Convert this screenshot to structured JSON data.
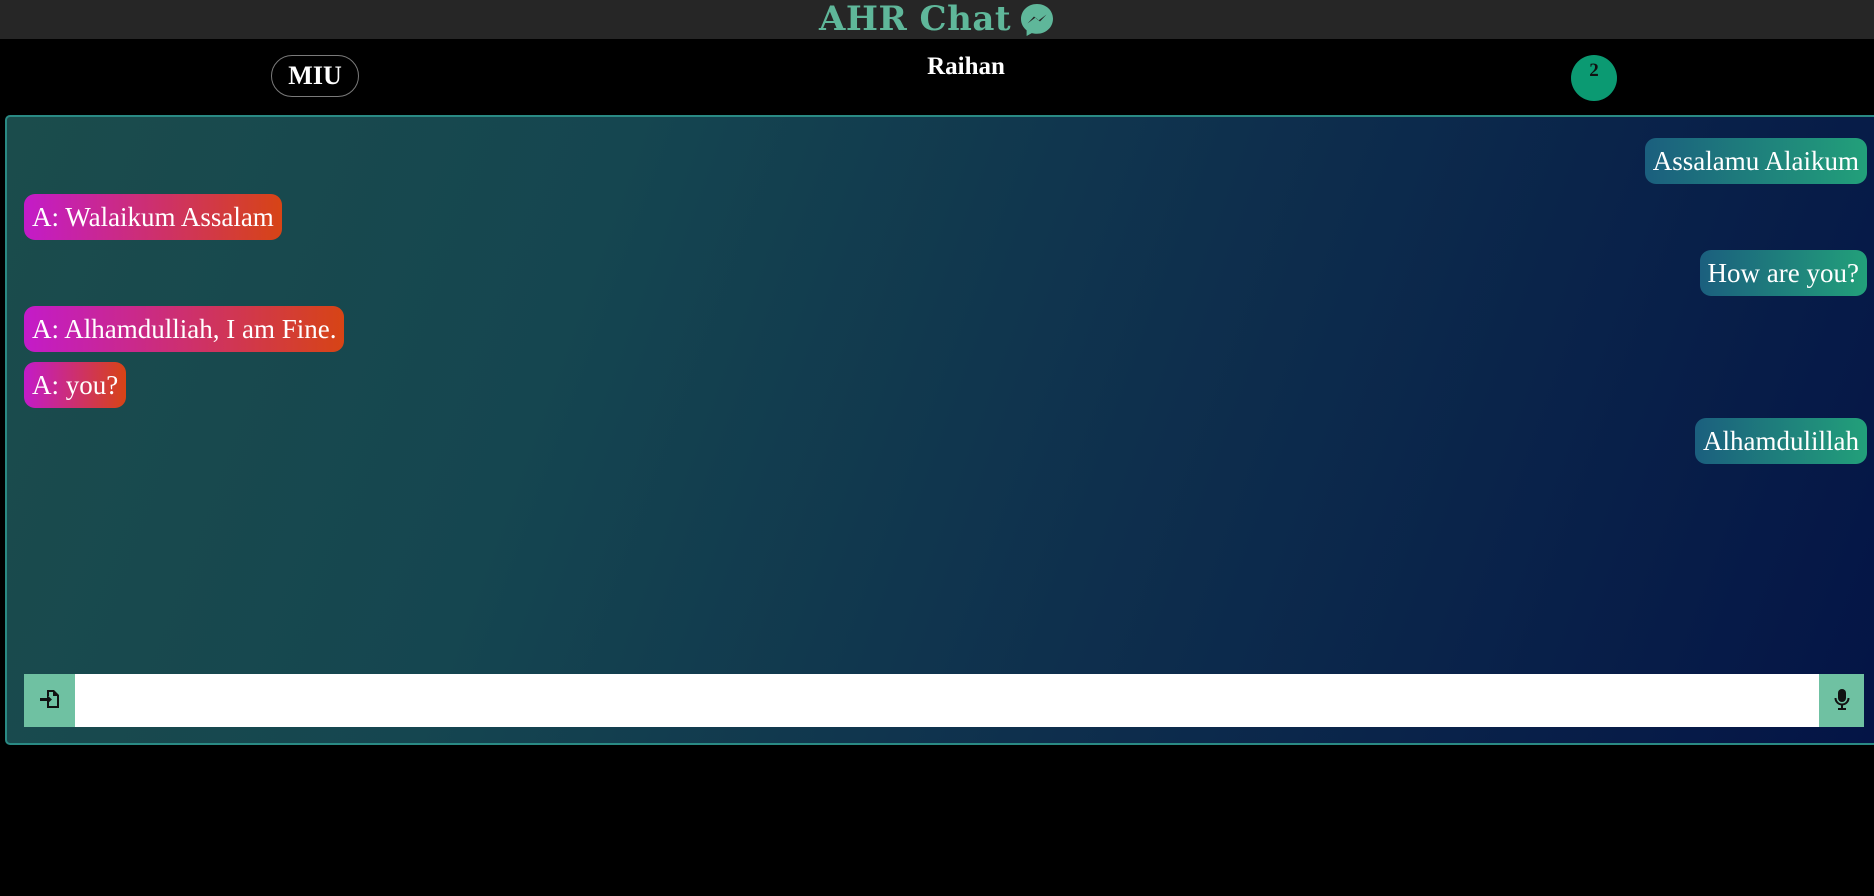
{
  "app": {
    "title": "AHR Chat",
    "title_color": "#5fb79a",
    "icon": "messenger-icon"
  },
  "header": {
    "room_label": "MIU",
    "user_name": "Raihan",
    "online_count": "2",
    "badge_color": "#0b9a72"
  },
  "messages": [
    {
      "direction": "outgoing",
      "text": "Assalamu Alaikum"
    },
    {
      "direction": "incoming",
      "text": "A: Walaikum Assalam"
    },
    {
      "direction": "outgoing",
      "text": "How are you?"
    },
    {
      "direction": "incoming",
      "text": "A: Alhamdulliah, I am Fine."
    },
    {
      "direction": "incoming",
      "text": "A: you?"
    },
    {
      "direction": "outgoing",
      "text": "Alhamdulillah"
    }
  ],
  "composer": {
    "value": "",
    "placeholder": "",
    "attach_icon": "file-import-icon",
    "mic_icon": "microphone-icon",
    "button_color": "#6fc1a2"
  },
  "colors": {
    "outgoing_bubble": [
      "#1b5f7e",
      "#22a07a"
    ],
    "incoming_bubble": [
      "#c31bc9",
      "#d74415"
    ],
    "panel_border": "#2a8a84"
  }
}
